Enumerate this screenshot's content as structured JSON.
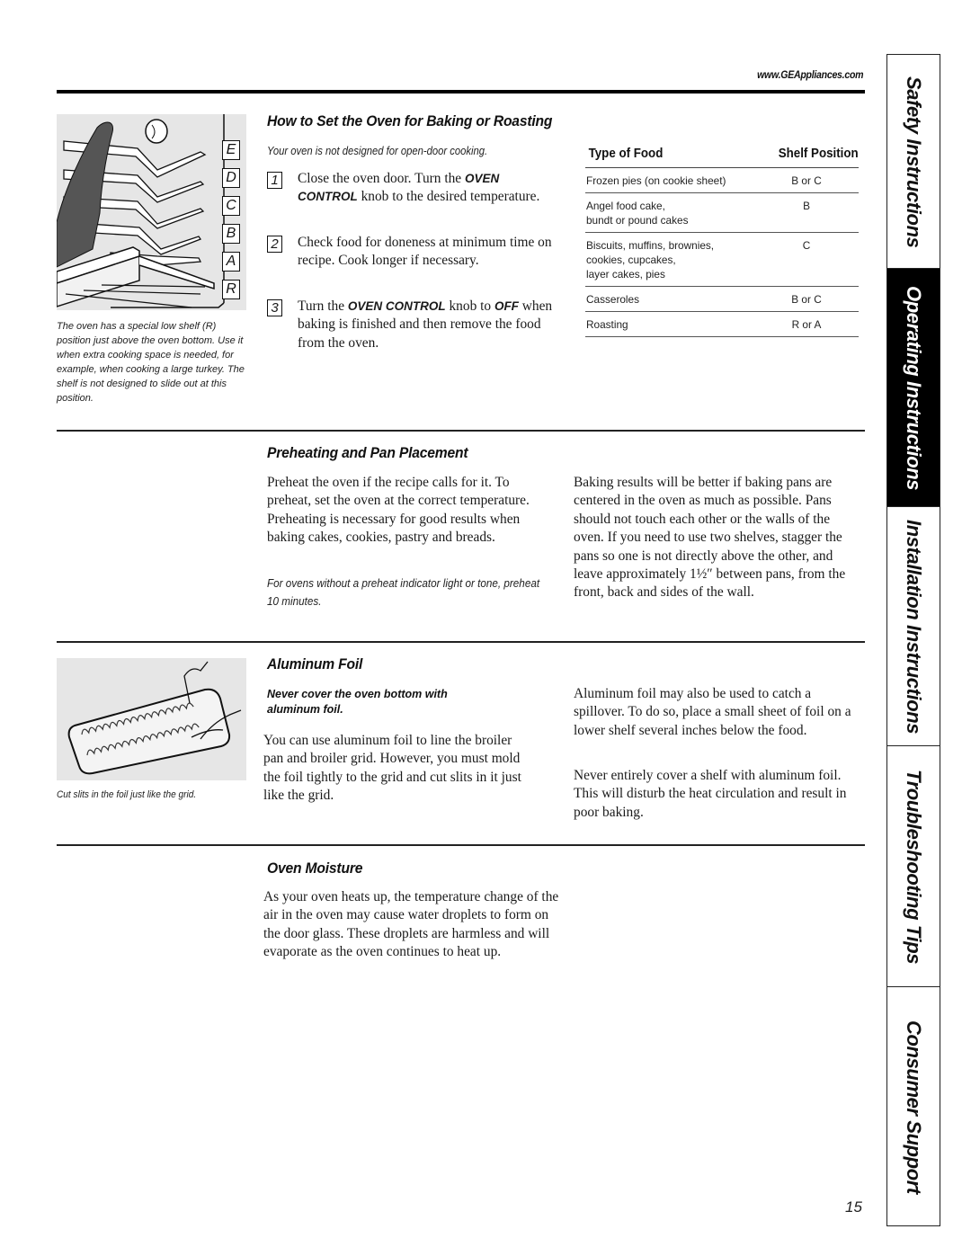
{
  "header": {
    "url": "www.GEAppliances.com"
  },
  "sidebar": {
    "tabs": [
      {
        "label": "Safety Instructions",
        "active": false
      },
      {
        "label": "Operating Instructions",
        "active": true
      },
      {
        "label": "Installation Instructions",
        "active": false
      },
      {
        "label": "Troubleshooting Tips",
        "active": false
      },
      {
        "label": "Consumer Support",
        "active": false
      }
    ]
  },
  "figure_shelves": {
    "labels": [
      "E",
      "D",
      "C",
      "B",
      "A",
      "R"
    ],
    "caption": "The oven has a special low shelf (R) position just above the oven bottom. Use it when extra cooking space is needed, for example, when cooking a large turkey. The shelf is not designed to slide out at this position."
  },
  "baking": {
    "title": "How to Set the Oven for Baking or Roasting",
    "note": "Your oven is not designed for open-door cooking.",
    "steps": [
      {
        "num": "1",
        "pre": "Close the oven door. Turn the ",
        "kw1": "OVEN CONTROL",
        "post": " knob to the desired temperature."
      },
      {
        "num": "2",
        "text": "Check food for doneness at minimum time on recipe. Cook longer if necessary."
      },
      {
        "num": "3",
        "pre": "Turn the ",
        "kw1": "OVEN CONTROL",
        "mid": " knob to ",
        "kw2": "OFF",
        "post": " when baking is finished and then remove the food from the oven."
      }
    ],
    "table": {
      "headers": [
        "Type of Food",
        "Shelf Position"
      ],
      "rows": [
        {
          "food": "Frozen pies (on cookie sheet)",
          "position": "B or C"
        },
        {
          "food": "Angel food cake,\nbundt or pound cakes",
          "position": "B"
        },
        {
          "food": "Biscuits, muffins, brownies,\ncookies, cupcakes,\nlayer cakes, pies",
          "position": "C"
        },
        {
          "food": "Casseroles",
          "position": "B or C"
        },
        {
          "food": "Roasting",
          "position": "R or A"
        }
      ]
    }
  },
  "preheating": {
    "title": "Preheating and Pan Placement",
    "left_text": "Preheat the oven if the recipe calls for it. To preheat, set the oven at the correct temperature. Preheating is necessary for good results when baking cakes, cookies, pastry and breads.",
    "left_note": "For ovens without a preheat indicator light or tone, preheat 10 minutes.",
    "right_text": "Baking results will be better if baking pans are centered in the oven as much as possible. Pans should not touch each other or the walls of the oven. If you need to use two shelves, stagger the pans so one is not directly above the other, and leave approximately 1½″ between pans, from the front, back and sides of the wall."
  },
  "foil": {
    "title": "Aluminum Foil",
    "warning": "Never cover the oven bottom with aluminum foil.",
    "left_text": "You can use aluminum foil to line the broiler pan and broiler grid. However, you must mold the foil tightly to the grid and cut slits in it just like the grid.",
    "right_text_1": "Aluminum foil may also be used to catch a spillover. To do so, place a small sheet of foil on a lower shelf several inches below the food.",
    "right_text_2": "Never entirely cover a shelf with aluminum foil. This will disturb the heat circulation and result in poor baking.",
    "figure_caption": "Cut slits in the foil just like the grid."
  },
  "moisture": {
    "title": "Oven Moisture",
    "text": "As your oven heats up, the temperature change of the air in the oven may cause water droplets to form on the door glass. These droplets are harmless and will evaporate as the oven continues to heat up."
  },
  "footer": {
    "page_number": "15"
  }
}
